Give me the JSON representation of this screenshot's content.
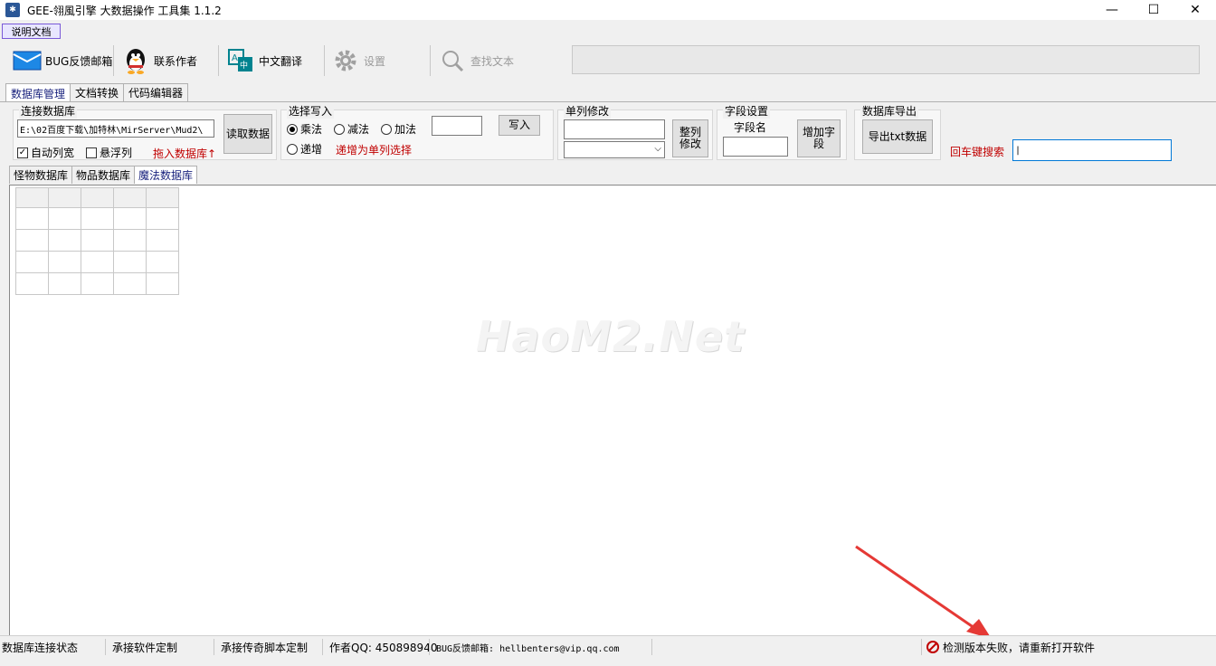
{
  "window": {
    "title": "GEE-翎風引擎 大数据操作 工具集  1.1.2",
    "minimize": "—",
    "maximize": "☐",
    "close": "✕"
  },
  "menu": {
    "doc_button": "说明文档"
  },
  "toolbar": {
    "bug_mail": "BUG反馈邮箱",
    "contact_author": "联系作者",
    "translate": "中文翻译",
    "settings": "设置",
    "find_text": "查找文本"
  },
  "tabs": [
    {
      "label": "数据库管理",
      "active": true
    },
    {
      "label": "文档转换",
      "active": false
    },
    {
      "label": "代码编辑器",
      "active": false
    }
  ],
  "connect": {
    "title": "连接数据库",
    "path": "E:\\02百度下载\\加特林\\MirServer\\Mud2\\",
    "read_button": "读取数据",
    "auto_width": "自动列宽",
    "auto_width_checked": true,
    "float_column": "悬浮列",
    "float_column_checked": false,
    "drag_hint": "拖入数据库↑"
  },
  "write": {
    "title": "选择写入",
    "multiply": "乘法",
    "subtract": "减法",
    "add": "加法",
    "increment": "递增",
    "selected": "multiply",
    "write_button": "写入",
    "increment_hint": "递增为单列选择"
  },
  "single_col": {
    "title": "单列修改",
    "whole_col_button": "整列\n修改"
  },
  "field": {
    "title": "字段设置",
    "field_name_label": "字段名",
    "add_field_button": "增加字\n段"
  },
  "export": {
    "title": "数据库导出",
    "export_button": "导出txt数据"
  },
  "search": {
    "label": "回车键搜索"
  },
  "subtabs": [
    {
      "label": "怪物数据库",
      "active": false
    },
    {
      "label": "物品数据库",
      "active": false
    },
    {
      "label": "魔法数据库",
      "active": true
    }
  ],
  "watermark": "HaoM2.Net",
  "status": {
    "db_state": "数据库连接状态",
    "custom_software": "承接软件定制",
    "custom_script": "承接传奇脚本定制",
    "author_qq": "作者QQ: 450898940",
    "bug_email": "BUG反馈邮箱: hellbenters@vip.qq.com",
    "version_check": "检测版本失败，请重新打开软件"
  },
  "colors": {
    "accent": "#1a237e",
    "warning": "#c00000",
    "arrow": "#e53935"
  }
}
